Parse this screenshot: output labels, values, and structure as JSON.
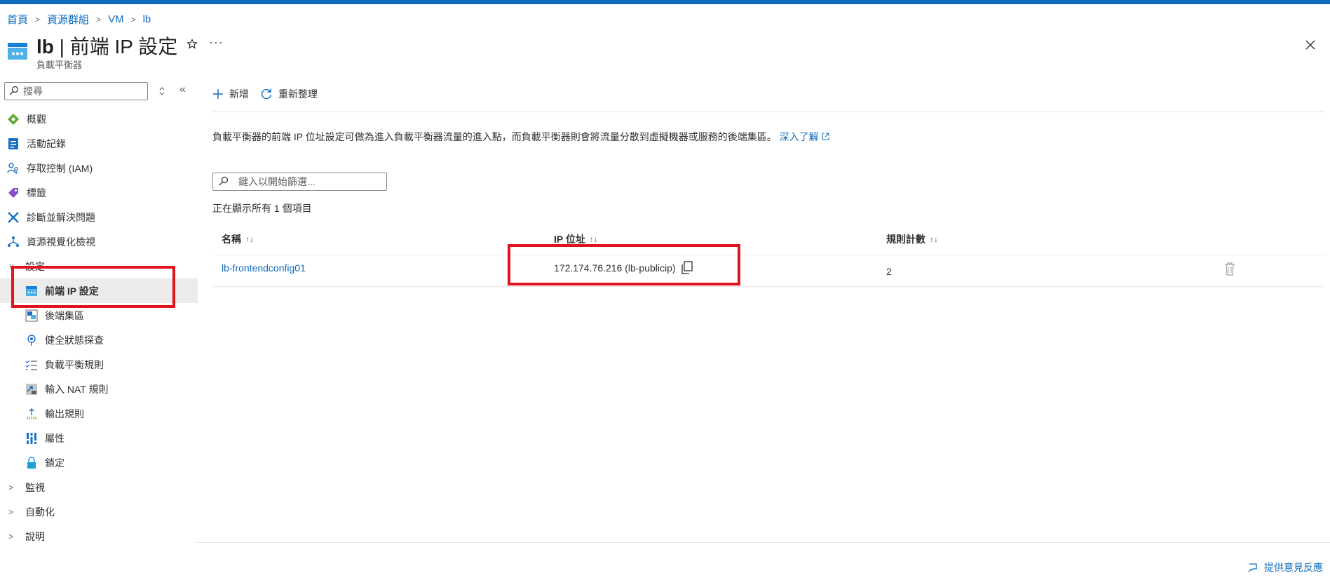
{
  "breadcrumb": [
    "首頁",
    "資源群組",
    "VM",
    "lb"
  ],
  "header": {
    "title_prefix": "lb",
    "title_rest": " | 前端 IP 設定",
    "subtitle": "負載平衡器",
    "more": "···"
  },
  "sidebar": {
    "search_placeholder": "搜尋",
    "items": [
      {
        "label": "概觀",
        "icon": "overview-icon"
      },
      {
        "label": "活動記錄",
        "icon": "activity-log-icon"
      },
      {
        "label": "存取控制 (IAM)",
        "icon": "iam-icon"
      },
      {
        "label": "標籤",
        "icon": "tag-icon"
      },
      {
        "label": "診斷並解決問題",
        "icon": "wrench-icon"
      },
      {
        "label": "資源視覺化檢視",
        "icon": "visualizer-icon"
      }
    ],
    "settings_group": "設定",
    "settings_items": [
      {
        "label": "前端 IP 設定",
        "icon": "frontend-ip-icon",
        "selected": true
      },
      {
        "label": "後端集區",
        "icon": "backend-pool-icon"
      },
      {
        "label": "健全狀態探查",
        "icon": "health-probe-icon"
      },
      {
        "label": "負載平衡規則",
        "icon": "lb-rules-icon"
      },
      {
        "label": "輸入 NAT 規則",
        "icon": "inbound-nat-icon"
      },
      {
        "label": "輸出規則",
        "icon": "outbound-rules-icon"
      },
      {
        "label": "屬性",
        "icon": "properties-icon"
      },
      {
        "label": "鎖定",
        "icon": "lock-icon"
      }
    ],
    "groups": [
      "監視",
      "自動化",
      "說明"
    ]
  },
  "toolbar": {
    "add_label": "新增",
    "refresh_label": "重新整理"
  },
  "description": {
    "text": "負載平衡器的前端 IP 位址設定可做為進入負載平衡器流量的進入點，而負載平衡器則會將流量分散到虛擬機器或服務的後端集區。 ",
    "learn_more": "深入了解"
  },
  "filter": {
    "placeholder": "鍵入以開始篩選..."
  },
  "count_text": "正在顯示所有 1 個項目",
  "table": {
    "columns": [
      "名稱",
      "IP 位址",
      "規則計數"
    ],
    "sort_glyph": "↑↓",
    "rows": [
      {
        "name": "lb-frontendconfig01",
        "ip": "172.174.76.216 (lb-publicip)",
        "rule_count": "2"
      }
    ]
  },
  "feedback_label": "提供意見反應",
  "colors": {
    "accent": "#0f6cbd",
    "highlight_box": "#e0141e"
  }
}
